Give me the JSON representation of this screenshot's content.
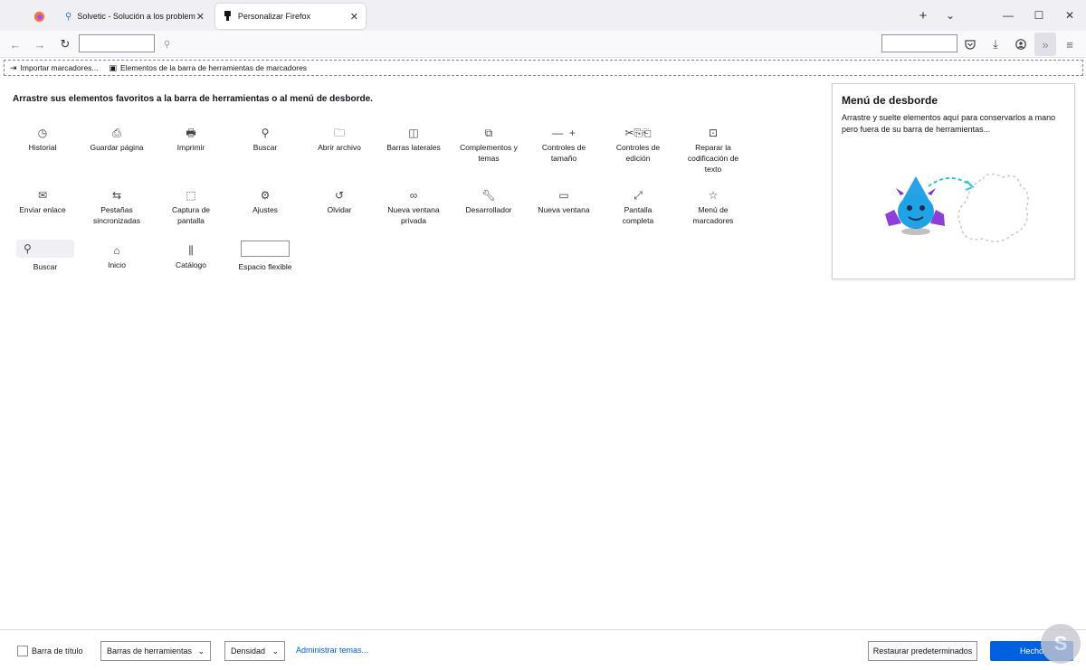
{
  "tabs": [
    {
      "label": "",
      "icon": "firefox-icon"
    },
    {
      "label": "Solvetic - Solución a los problem",
      "icon": "search-icon"
    },
    {
      "label": "Personalizar Firefox",
      "icon": "customize-icon"
    }
  ],
  "window_controls": {
    "new_tab": "+",
    "list_tabs": "⌄",
    "minimize": "—",
    "maximize": "☐",
    "close": "✕"
  },
  "bookmarks_bar": {
    "import": "Importar marcadores...",
    "toolbar_items": "Elementos de la barra de herramientas de marcadores"
  },
  "instructions": "Arrastre sus elementos favoritos a la barra de herramientas o al menú de desborde.",
  "palette": [
    {
      "label": "Historial",
      "icon": "clock-icon"
    },
    {
      "label": "Guardar página",
      "icon": "save-page-icon"
    },
    {
      "label": "Imprimir",
      "icon": "print-icon"
    },
    {
      "label": "Buscar",
      "icon": "search-icon"
    },
    {
      "label": "Abrir archivo",
      "icon": "open-file-icon"
    },
    {
      "label": "Barras laterales",
      "icon": "sidebar-icon"
    },
    {
      "label": "Complementos y temas",
      "icon": "puzzle-icon"
    },
    {
      "label": "Controles de tamaño",
      "icon": "zoom-icon"
    },
    {
      "label": "Controles de edición",
      "icon": "edit-icon"
    },
    {
      "label": "Reparar la codificación de texto",
      "icon": "text-encoding-icon"
    },
    {
      "label": "Enviar enlace",
      "icon": "mail-icon"
    },
    {
      "label": "Pestañas sincronizadas",
      "icon": "synced-tabs-icon"
    },
    {
      "label": "Captura de pantalla",
      "icon": "screenshot-icon"
    },
    {
      "label": "Ajustes",
      "icon": "gear-icon"
    },
    {
      "label": "Olvidar",
      "icon": "forget-icon"
    },
    {
      "label": "Nueva ventana privada",
      "icon": "private-mask-icon"
    },
    {
      "label": "Desarrollador",
      "icon": "wrench-icon"
    },
    {
      "label": "Nueva ventana",
      "icon": "new-window-icon"
    },
    {
      "label": "Pantalla completa",
      "icon": "fullscreen-icon"
    },
    {
      "label": "Menú de marcadores",
      "icon": "bookmarks-menu-icon"
    },
    {
      "label": "Buscar",
      "icon": "search-icon"
    },
    {
      "label": "Inicio",
      "icon": "home-icon"
    },
    {
      "label": "Catálogo",
      "icon": "library-icon"
    },
    {
      "label": "Espacio flexible",
      "icon": "flexible-space-icon"
    }
  ],
  "overflow_panel": {
    "title": "Menú de desborde",
    "description": "Arrastre y suelte elementos aquí para conservarlos a mano pero fuera de su barra de herramientas..."
  },
  "footer": {
    "title_bar_label": "Barra de título",
    "toolbars_select": "Barras de herramientas",
    "density_select": "Densidad",
    "manage_themes": "Administrar temas...",
    "restore_defaults": "Restaurar predeterminados",
    "done": "Hecho"
  },
  "colors": {
    "accent": "#0061e0",
    "chrome_bg": "#f0f0f4"
  }
}
